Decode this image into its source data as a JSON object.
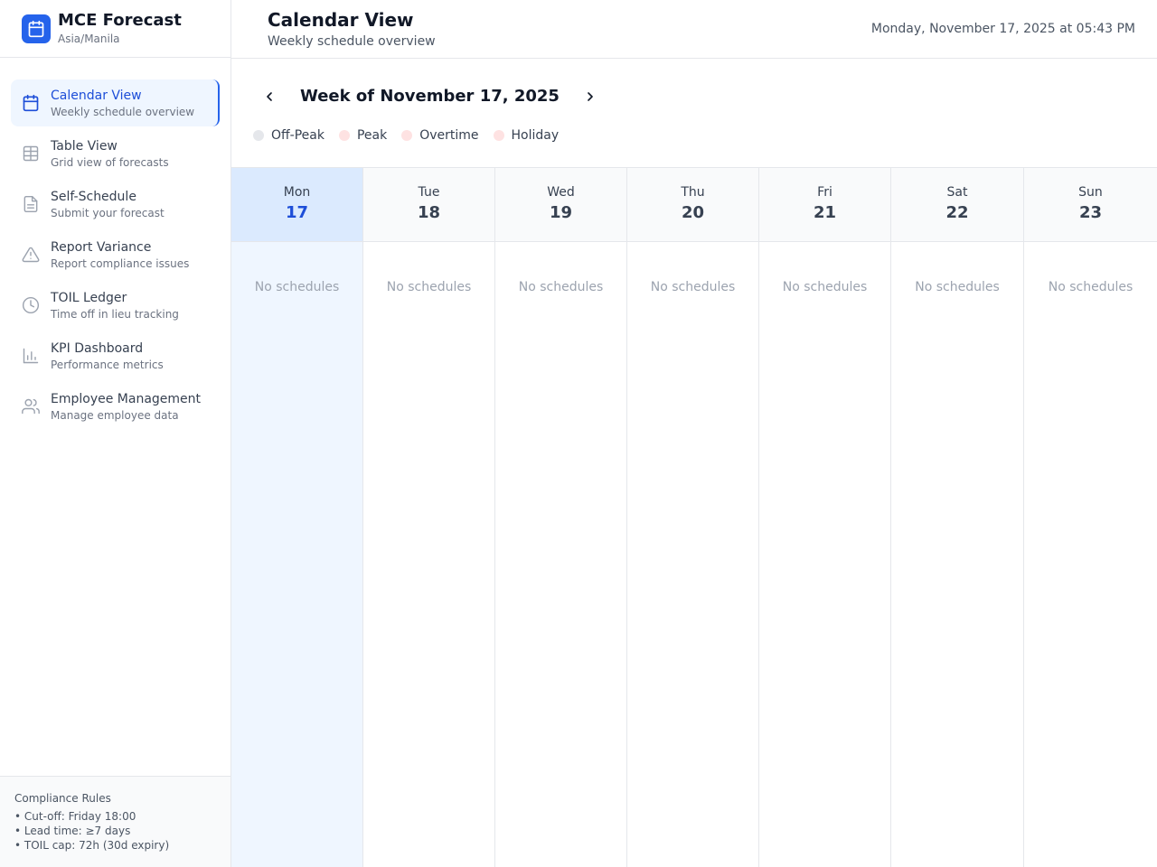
{
  "brand": {
    "title": "MCE Forecast",
    "timezone": "Asia/Manila",
    "icon": "calendar-icon",
    "color": "#2563eb"
  },
  "sidebar": {
    "items": [
      {
        "label": "Calendar View",
        "desc": "Weekly schedule overview",
        "icon": "calendar-icon",
        "active": true
      },
      {
        "label": "Table View",
        "desc": "Grid view of forecasts",
        "icon": "table-icon",
        "active": false
      },
      {
        "label": "Self-Schedule",
        "desc": "Submit your forecast",
        "icon": "document-icon",
        "active": false
      },
      {
        "label": "Report Variance",
        "desc": "Report compliance issues",
        "icon": "warning-icon",
        "active": false
      },
      {
        "label": "TOIL Ledger",
        "desc": "Time off in lieu tracking",
        "icon": "clock-icon",
        "active": false
      },
      {
        "label": "KPI Dashboard",
        "desc": "Performance metrics",
        "icon": "bar-chart-icon",
        "active": false
      },
      {
        "label": "Employee Management",
        "desc": "Manage employee data",
        "icon": "users-icon",
        "active": false
      }
    ]
  },
  "compliance": {
    "title": "Compliance Rules",
    "rules": [
      "• Cut-off: Friday 18:00",
      "• Lead time: ≥7 days",
      "• TOIL cap: 72h (30d expiry)"
    ]
  },
  "header": {
    "title": "Calendar View",
    "subtitle": "Weekly schedule overview",
    "datetime": "Monday, November 17, 2025 at 05:43 PM"
  },
  "week": {
    "title": "Week of November 17, 2025",
    "prev_icon": "chevron-left-icon",
    "next_icon": "chevron-right-icon"
  },
  "legend": [
    {
      "label": "Off-Peak",
      "color": "#e5e7eb"
    },
    {
      "label": "Peak",
      "color": "#fee2e2"
    },
    {
      "label": "Overtime",
      "color": "#fee2e2"
    },
    {
      "label": "Holiday",
      "color": "#fee2e2"
    }
  ],
  "days": [
    {
      "name": "Mon",
      "num": "17",
      "today": true,
      "empty": "No schedules"
    },
    {
      "name": "Tue",
      "num": "18",
      "today": false,
      "empty": "No schedules"
    },
    {
      "name": "Wed",
      "num": "19",
      "today": false,
      "empty": "No schedules"
    },
    {
      "name": "Thu",
      "num": "20",
      "today": false,
      "empty": "No schedules"
    },
    {
      "name": "Fri",
      "num": "21",
      "today": false,
      "empty": "No schedules"
    },
    {
      "name": "Sat",
      "num": "22",
      "today": false,
      "empty": "No schedules"
    },
    {
      "name": "Sun",
      "num": "23",
      "today": false,
      "empty": "No schedules"
    }
  ]
}
